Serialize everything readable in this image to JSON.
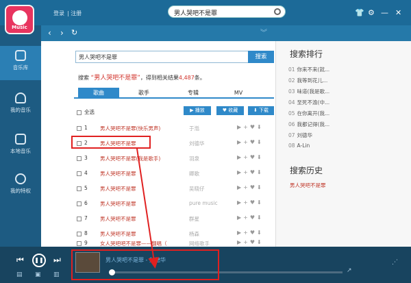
{
  "app": {
    "logo_label": "Music",
    "login": "登录",
    "register": "注册",
    "top_search": "男人哭吧不是罪"
  },
  "sidebar": {
    "items": [
      {
        "label": "音乐库",
        "icon": "music-note-icon"
      },
      {
        "label": "我的音乐",
        "icon": "headphones-icon"
      },
      {
        "label": "本地音乐",
        "icon": "folder-icon"
      },
      {
        "label": "我的特权",
        "icon": "crown-icon"
      }
    ]
  },
  "search": {
    "query": "男人哭吧不是罪",
    "button": "搜索",
    "result_prefix": "搜索",
    "result_query": "“男人哭吧不是罪”",
    "result_mid": "，得到相关结果",
    "result_count": "4,487",
    "result_suffix": "条。"
  },
  "tabs": [
    "歌曲",
    "歌手",
    "专辑",
    "MV"
  ],
  "toolbar": {
    "select_all": "全选",
    "play": "播放",
    "fav": "收藏",
    "download": "下载"
  },
  "songs": [
    {
      "idx": "1",
      "title": "男人哭吧不是罪(快乐男声)",
      "artist": "于湉"
    },
    {
      "idx": "2",
      "title": "男人哭吧不是罪",
      "artist": "刘德华"
    },
    {
      "idx": "3",
      "title": "男人哭吧不是罪(我是歌手)",
      "artist": "羽泉"
    },
    {
      "idx": "4",
      "title": "男人哭吧不是罪",
      "artist": "卿歌"
    },
    {
      "idx": "5",
      "title": "男人哭吧不是罪",
      "artist": "吴晓仔"
    },
    {
      "idx": "6",
      "title": "男人哭吧不是罪",
      "artist": "pure music"
    },
    {
      "idx": "7",
      "title": "男人哭吧不是罪",
      "artist": "群星"
    },
    {
      "idx": "8",
      "title": "男人哭吧不是罪",
      "artist": "杨森"
    },
    {
      "idx": "9",
      "title": "女人哭吧吧不是罪——翻唱（",
      "artist": "网络歌手"
    }
  ],
  "ranking": {
    "title": "搜索排行",
    "items": [
      {
        "n": "01",
        "text": "你来不来(就..."
      },
      {
        "n": "02",
        "text": "我等到花儿..."
      },
      {
        "n": "03",
        "text": "味道(我是歌..."
      },
      {
        "n": "04",
        "text": "至死不渝(中..."
      },
      {
        "n": "05",
        "text": "在你离开(我..."
      },
      {
        "n": "06",
        "text": "我都记得(我..."
      },
      {
        "n": "07",
        "text": "刘德华"
      },
      {
        "n": "08",
        "text": "A-Lin"
      }
    ]
  },
  "history": {
    "title": "搜索历史",
    "items": [
      "男人哭吧不是罪"
    ]
  },
  "player": {
    "now_playing": "男人哭吧不是罪 - 刘德华",
    "progress": 0.01
  },
  "colors": {
    "accent": "#2f89c9",
    "song_title": "#c0392b",
    "annotation": "#e02020"
  }
}
